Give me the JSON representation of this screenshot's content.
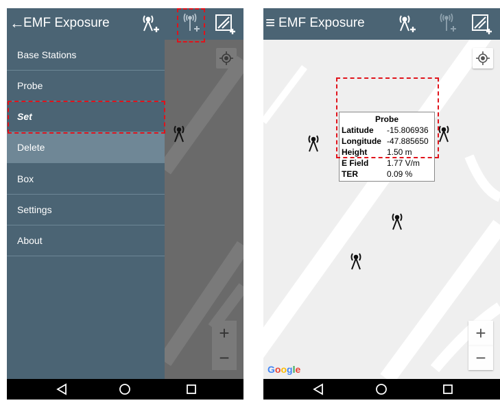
{
  "left_screen": {
    "appbar": {
      "back_icon": "←",
      "title": "EMF Exposure"
    },
    "menu": [
      {
        "label": "Base Stations",
        "state": "normal"
      },
      {
        "label": "Probe",
        "state": "normal"
      },
      {
        "label": "Set",
        "state": "active"
      },
      {
        "label": "Delete",
        "state": "highlighted"
      },
      {
        "label": "Box",
        "state": "normal"
      },
      {
        "label": "Settings",
        "state": "normal"
      },
      {
        "label": "About",
        "state": "normal"
      }
    ],
    "zoom_in": "+",
    "zoom_out": "−"
  },
  "right_screen": {
    "appbar": {
      "menu_icon": "≡",
      "title": "EMF Exposure"
    },
    "probe_popup": {
      "title": "Probe",
      "rows": [
        {
          "key": "Latitude",
          "value": "-15.806936"
        },
        {
          "key": "Longitude",
          "value": "-47.885650"
        },
        {
          "key": "Height",
          "value": "1.50 m"
        },
        {
          "key": "E Field",
          "value": "1.77 V/m"
        },
        {
          "key": "TER",
          "value": "0.09 %"
        }
      ]
    },
    "google_logo": [
      "G",
      "o",
      "o",
      "g",
      "l",
      "e"
    ],
    "zoom_in": "+",
    "zoom_out": "−"
  },
  "icons": {
    "add_base_station": "antenna-plus-icon",
    "add_probe": "probe-plus-icon",
    "add_box": "box-plus-icon",
    "locate": "my-location-icon",
    "tower": "radio-tower-icon",
    "nav_back": "triangle-back-icon",
    "nav_home": "circle-home-icon",
    "nav_recent": "square-recent-icon"
  },
  "colors": {
    "appbar": "#4b6474",
    "drawer_highlight": "#6f8796",
    "annotation": "#e0121a",
    "map_dim": "#6a6a6a",
    "map": "#efefef"
  }
}
